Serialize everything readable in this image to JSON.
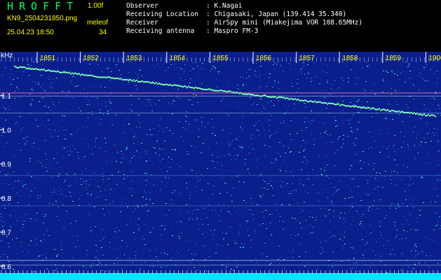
{
  "header": {
    "title": "HROFFT",
    "version": "1.00f",
    "filename": "KN9_2504231850.png",
    "mode": "meleof",
    "datetime": "25.04.23 18:50",
    "count": "34"
  },
  "info": [
    {
      "key": "Observer",
      "value": ": K.Nagai"
    },
    {
      "key": "Receiving Location",
      "value": ": Chigasaki, Japan (139.414 35.340)"
    },
    {
      "key": "Receiver",
      "value": ": AirSpy mini (Miakejima VOR 108.65MHz)"
    },
    {
      "key": "Receiving antenna",
      "value": ": Maspro FM-3"
    }
  ],
  "spectrogram": {
    "y_unit": "kHz",
    "y_min": 0.58,
    "y_max": 1.2,
    "y_ticks": [
      "1.1",
      "1.0",
      "0.9",
      "0.8",
      "0.7",
      "0.6"
    ],
    "x_labels": [
      "1851",
      "1852",
      "1853",
      "1854",
      "1855",
      "1856",
      "1857",
      "1858",
      "1859",
      "1900"
    ],
    "colors": {
      "background": "#0a1f8c",
      "tick_label": "#ffff00",
      "axis_text": "#ffffff",
      "trace": "#7fffb0",
      "baseline": "#00e5ff",
      "interference": "#ff6fae"
    }
  }
}
